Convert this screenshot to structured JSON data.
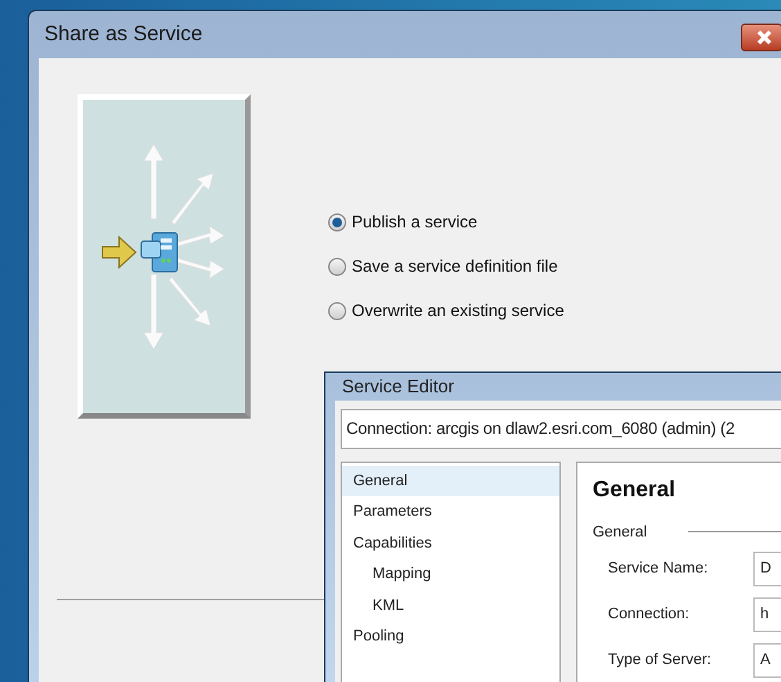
{
  "window": {
    "title": "Share as Service"
  },
  "options": [
    {
      "label": "Publish a service",
      "selected": true
    },
    {
      "label": "Save a service definition file",
      "selected": false
    },
    {
      "label": "Overwrite an existing service",
      "selected": false
    }
  ],
  "service_editor": {
    "title": "Service Editor",
    "connection": "Connection: arcgis on dlaw2.esri.com_6080 (admin) (2",
    "sidebar": {
      "items": [
        {
          "label": "General",
          "selected": true
        },
        {
          "label": "Parameters",
          "selected": false
        },
        {
          "label": "Capabilities",
          "selected": false,
          "children": [
            {
              "label": "Mapping",
              "selected": false
            },
            {
              "label": "KML",
              "selected": false
            }
          ]
        },
        {
          "label": "Pooling",
          "selected": false
        }
      ]
    },
    "panel": {
      "heading": "General",
      "group": "General",
      "fields": [
        {
          "label": "Service Name:",
          "value": "D"
        },
        {
          "label": "Connection:",
          "value": "h"
        },
        {
          "label": "Type of Server:",
          "value": "A"
        }
      ]
    }
  }
}
